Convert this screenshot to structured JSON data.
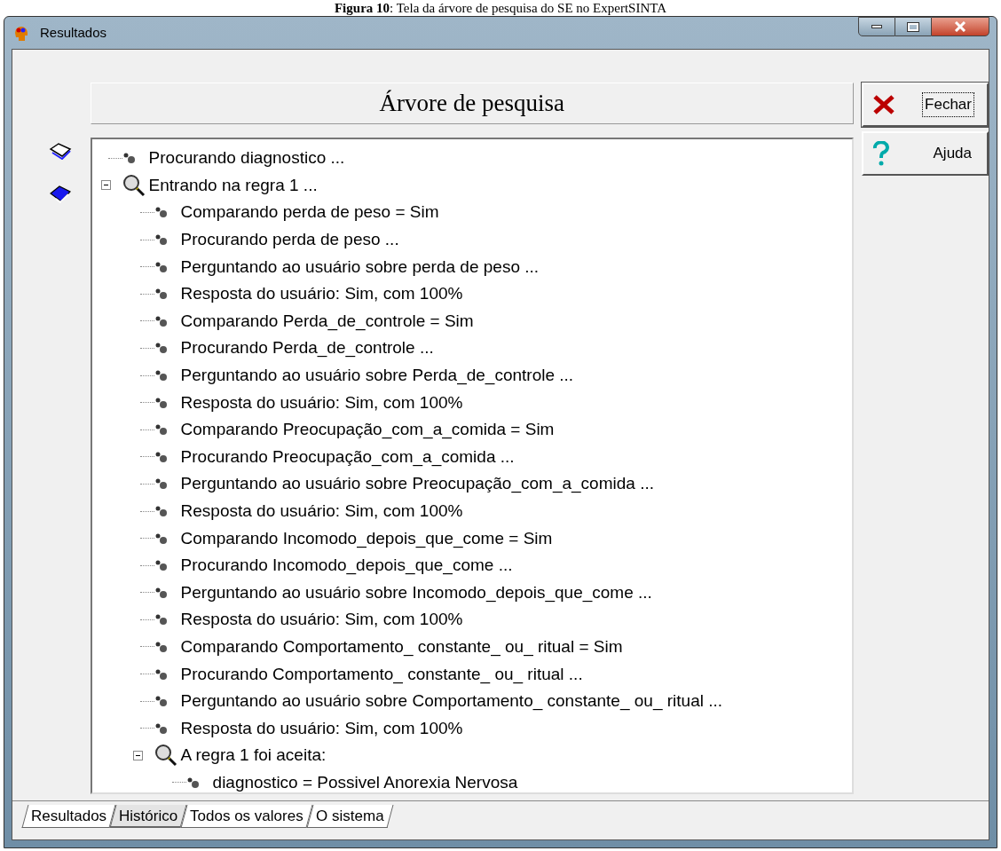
{
  "caption": "**Figura 10**: Tela da árvore de pesquisa do SE no ExpertSINTA",
  "window": {
    "title": "Resultados"
  },
  "heading": "Árvore de pesquisa",
  "buttons": [
    {
      "label": "Fechar",
      "kind": "close",
      "focused": true
    },
    {
      "label": "Ajuda",
      "kind": "help",
      "focused": false
    }
  ],
  "tree": [
    {
      "text": "Procurando diagnostico ...",
      "kind": "leaf"
    },
    {
      "text": "Entrando na regra 1 ...",
      "kind": "rule",
      "expanded": true,
      "children": [
        {
          "text": "Comparando perda de peso = Sim",
          "kind": "leaf"
        },
        {
          "text": "Procurando perda de peso ...",
          "kind": "leaf"
        },
        {
          "text": "Perguntando ao usuário sobre perda de peso ...",
          "kind": "leaf"
        },
        {
          "text": "Resposta do usuário: Sim, com 100%",
          "kind": "leaf"
        },
        {
          "text": "Comparando Perda_de_controle = Sim",
          "kind": "leaf"
        },
        {
          "text": "Procurando Perda_de_controle ...",
          "kind": "leaf"
        },
        {
          "text": "Perguntando ao usuário sobre Perda_de_controle ...",
          "kind": "leaf"
        },
        {
          "text": "Resposta do usuário: Sim, com 100%",
          "kind": "leaf"
        },
        {
          "text": "Comparando Preocupação_com_a_comida = Sim",
          "kind": "leaf"
        },
        {
          "text": "Procurando Preocupação_com_a_comida ...",
          "kind": "leaf"
        },
        {
          "text": "Perguntando ao usuário sobre Preocupação_com_a_comida ...",
          "kind": "leaf"
        },
        {
          "text": "Resposta do usuário: Sim, com 100%",
          "kind": "leaf"
        },
        {
          "text": "Comparando Incomodo_depois_que_come = Sim",
          "kind": "leaf"
        },
        {
          "text": "Procurando Incomodo_depois_que_come ...",
          "kind": "leaf"
        },
        {
          "text": "Perguntando ao usuário sobre Incomodo_depois_que_come ...",
          "kind": "leaf"
        },
        {
          "text": "Resposta do usuário: Sim, com 100%",
          "kind": "leaf"
        },
        {
          "text": "Comparando Comportamento_ constante_ ou_ ritual = Sim",
          "kind": "leaf"
        },
        {
          "text": "Procurando Comportamento_ constante_ ou_ ritual ...",
          "kind": "leaf"
        },
        {
          "text": "Perguntando ao usuário sobre Comportamento_ constante_ ou_ ritual ...",
          "kind": "leaf"
        },
        {
          "text": "Resposta do usuário: Sim, com 100%",
          "kind": "leaf"
        },
        {
          "text": "A regra 1 foi aceita:",
          "kind": "rule",
          "expanded": true,
          "children": [
            {
              "text": "diagnostico = Possivel Anorexia Nervosa",
              "kind": "leaf"
            }
          ]
        }
      ]
    }
  ],
  "tabs": [
    {
      "label": "Resultados",
      "selected": false
    },
    {
      "label": "Histórico",
      "selected": true
    },
    {
      "label": "Todos os valores",
      "selected": false
    },
    {
      "label": "O sistema",
      "selected": false
    }
  ]
}
